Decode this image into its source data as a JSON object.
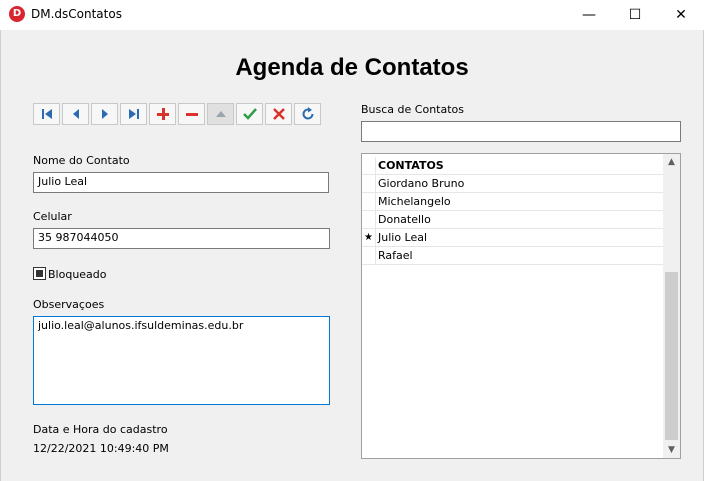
{
  "window": {
    "title": "DM.dsContatos",
    "icon": "delphi-app-icon",
    "minimize": "—",
    "maximize": "☐",
    "close": "✕"
  },
  "heading": "Agenda de Contatos",
  "navigator": [
    "first",
    "prior",
    "next",
    "last",
    "insert",
    "delete",
    "edit",
    "post",
    "cancel",
    "refresh"
  ],
  "form": {
    "nome_label": "Nome do Contato",
    "nome_value": "Julio Leal",
    "celular_label": "Celular",
    "celular_value": "35 987044050",
    "bloqueado_label": "Bloqueado",
    "obs_label": "Observaçoes",
    "obs_value": "julio.leal@alunos.ifsuldeminas.edu.br",
    "data_label": "Data e Hora do cadastro",
    "data_value": "12/22/2021 10:49:40 PM"
  },
  "search": {
    "label": "Busca de Contatos",
    "value": ""
  },
  "grid": {
    "header": "CONTATOS",
    "rows": [
      {
        "name": "Giordano Bruno",
        "indicator": ""
      },
      {
        "name": "Michelangelo",
        "indicator": ""
      },
      {
        "name": "Donatello",
        "indicator": ""
      },
      {
        "name": "Julio Leal",
        "indicator": "★"
      },
      {
        "name": "Rafael",
        "indicator": ""
      }
    ]
  }
}
